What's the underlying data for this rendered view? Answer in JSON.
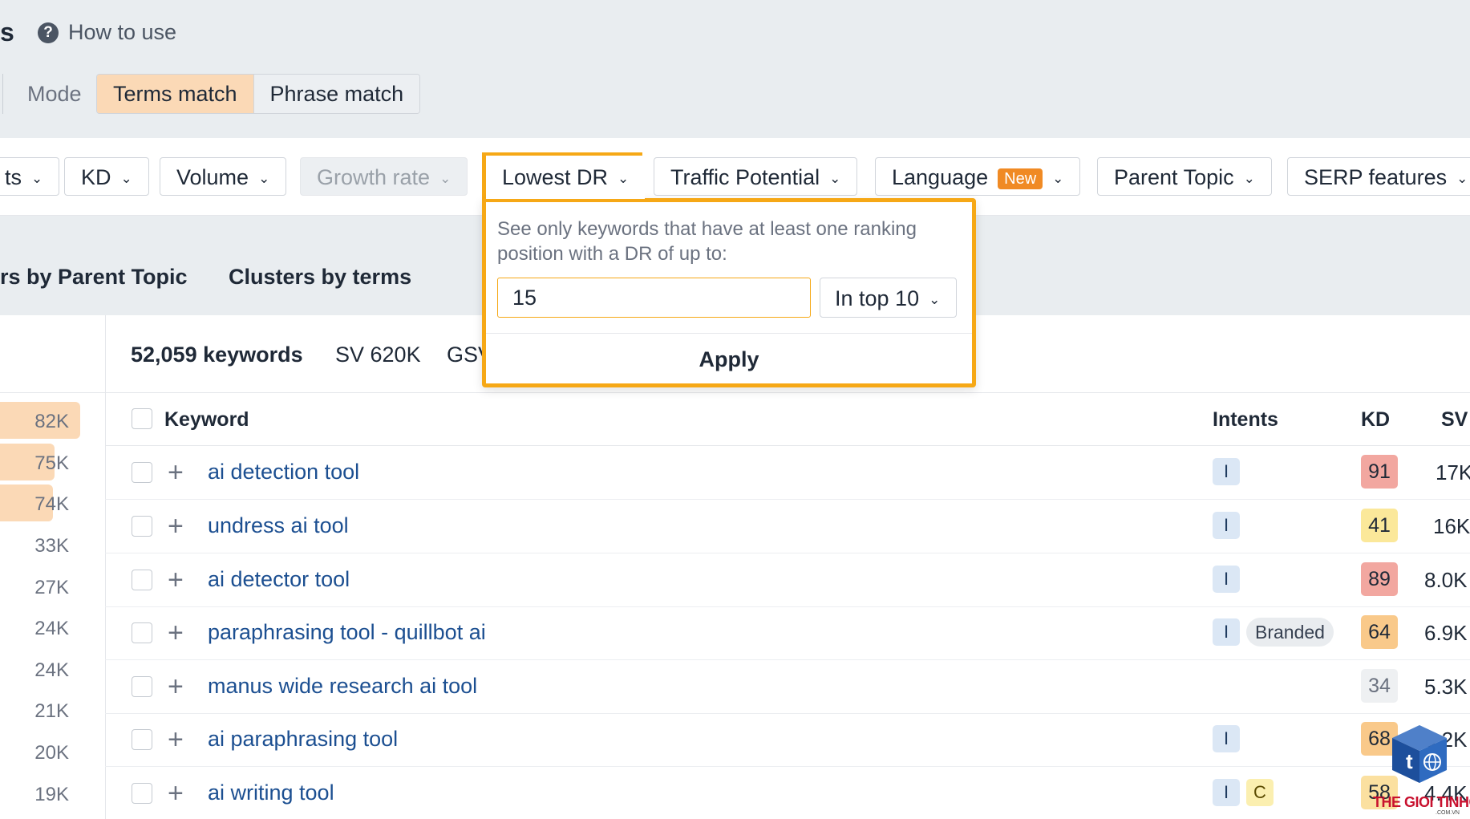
{
  "header": {
    "title_fragment": "s",
    "help_icon": "question-circle-icon",
    "how_to_use": "How to use",
    "mode_label": "Mode",
    "mode_options": [
      "Terms match",
      "Phrase match"
    ],
    "mode_selected": "Terms match"
  },
  "filters": {
    "truncated_chip": "ts",
    "kd": "KD",
    "volume": "Volume",
    "growth_rate": "Growth rate",
    "lowest_dr": "Lowest DR",
    "traffic_potential": "Traffic Potential",
    "language": "Language",
    "language_badge": "New",
    "parent_topic": "Parent Topic",
    "serp_features": "SERP features"
  },
  "tabs": {
    "by_parent_topic": "rs by Parent Topic",
    "by_terms": "Clusters by terms"
  },
  "popup": {
    "description": "See only keywords that have at least one ranking position with a DR of up to:",
    "input_value": "15",
    "position_select": "In top 10",
    "apply_label": "Apply"
  },
  "summary": {
    "keywords_count": "52,059 keywords",
    "sv": "SV 620K",
    "gsv_fragment": "GSV"
  },
  "histogram": {
    "values": [
      "82K",
      "75K",
      "74K",
      "33K",
      "27K",
      "24K",
      "24K",
      "21K",
      "20K",
      "19K"
    ],
    "highlighted_count": 3
  },
  "table": {
    "headers": {
      "keyword": "Keyword",
      "intents": "Intents",
      "kd": "KD",
      "sv": "SV"
    },
    "rows": [
      {
        "keyword": "ai detection tool",
        "intents": [
          "I"
        ],
        "branded": "",
        "kd": "91",
        "kd_color": "#f2a7a0",
        "sv": "17K"
      },
      {
        "keyword": "undress ai tool",
        "intents": [
          "I"
        ],
        "branded": "",
        "kd": "41",
        "kd_color": "#fbe89a",
        "sv": "16K"
      },
      {
        "keyword": "ai detector tool",
        "intents": [
          "I"
        ],
        "branded": "",
        "kd": "89",
        "kd_color": "#f2a7a0",
        "sv": "8.0K"
      },
      {
        "keyword": "paraphrasing tool - quillbot ai",
        "intents": [
          "I"
        ],
        "branded": "Branded",
        "kd": "64",
        "kd_color": "#f9c98a",
        "sv": "6.9K"
      },
      {
        "keyword": "manus wide research ai tool",
        "intents": [],
        "branded": "",
        "kd": "34",
        "kd_color": "#eef0f2",
        "sv": "5.3K"
      },
      {
        "keyword": "ai paraphrasing tool",
        "intents": [
          "I"
        ],
        "branded": "",
        "kd": "68",
        "kd_color": "#f9c98a",
        "sv": "5.2K"
      },
      {
        "keyword": "ai writing tool",
        "intents": [
          "I",
          "C"
        ],
        "branded": "",
        "kd": "58",
        "kd_color": "#fbe0a0",
        "sv": "4.4K"
      }
    ]
  },
  "watermark": {
    "brand": "THE GIOI TINHOC",
    "sub": ".COM.VN",
    "icon": "cube-logo-icon"
  }
}
